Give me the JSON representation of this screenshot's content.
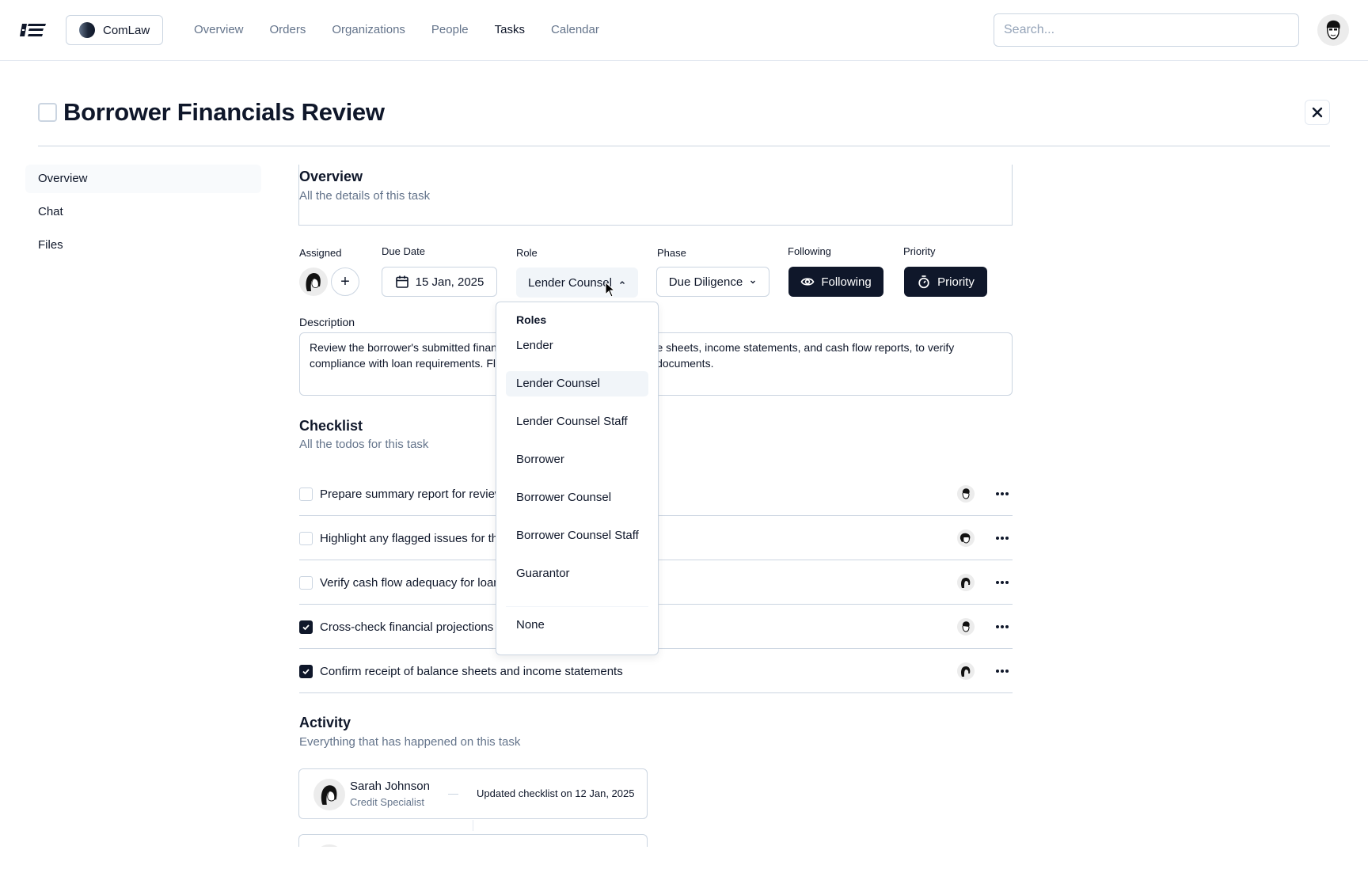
{
  "topbar": {
    "logo": "app-logo",
    "org": {
      "name": "ComLaw"
    },
    "nav": [
      {
        "label": "Overview",
        "active": false
      },
      {
        "label": "Orders",
        "active": false
      },
      {
        "label": "Organizations",
        "active": false
      },
      {
        "label": "People",
        "active": false
      },
      {
        "label": "Tasks",
        "active": true
      },
      {
        "label": "Calendar",
        "active": false
      }
    ],
    "search": {
      "placeholder": "Search...",
      "value": ""
    }
  },
  "task": {
    "title": "Borrower Financials Review",
    "completed": false
  },
  "sidebar": {
    "items": [
      {
        "label": "Overview",
        "active": true
      },
      {
        "label": "Chat",
        "active": false
      },
      {
        "label": "Files",
        "active": false
      }
    ]
  },
  "overview": {
    "title": "Overview",
    "subtitle": "All the details of this task"
  },
  "fields": {
    "assigned": {
      "label": "Assigned",
      "add_icon": "+"
    },
    "due_date": {
      "label": "Due Date",
      "value": "15 Jan, 2025"
    },
    "role": {
      "label": "Role",
      "value": "Lender Counsel"
    },
    "phase": {
      "label": "Phase",
      "value": "Due Diligence"
    },
    "following": {
      "label": "Following",
      "button": "Following"
    },
    "priority": {
      "label": "Priority",
      "button": "Priority"
    }
  },
  "description": {
    "label": "Description",
    "text": "Review the borrower's submitted financial documents, including balance sheets, income statements, and cash flow reports, to verify compliance with loan requirements. Flag any discrepancies or missing documents."
  },
  "checklist": {
    "title": "Checklist",
    "subtitle": "All the todos for this task",
    "items": [
      {
        "text": "Prepare summary report for review",
        "checked": false
      },
      {
        "text": "Highlight any flagged issues for the team",
        "checked": false
      },
      {
        "text": "Verify cash flow adequacy for loan repayment",
        "checked": false
      },
      {
        "text": "Cross-check financial projections",
        "checked": true
      },
      {
        "text": "Confirm receipt of balance sheets and income statements",
        "checked": true
      }
    ]
  },
  "activity": {
    "title": "Activity",
    "subtitle": "Everything that has happened on this task",
    "entries": [
      {
        "name": "Sarah Johnson",
        "role": "Credit Specialist",
        "text": "Updated checklist on 12 Jan, 2025"
      }
    ]
  },
  "role_dropdown": {
    "heading": "Roles",
    "options": [
      "Lender",
      "Lender Counsel",
      "Lender Counsel Staff",
      "Borrower",
      "Borrower Counsel",
      "Borrower Counsel Staff",
      "Guarantor"
    ],
    "none_option": "None",
    "selected": "Lender Counsel"
  },
  "colors": {
    "primary_dark": "#0f172a",
    "muted_text": "#64748b",
    "border": "#cbd5e1",
    "hover_bg": "#f1f5f9"
  }
}
